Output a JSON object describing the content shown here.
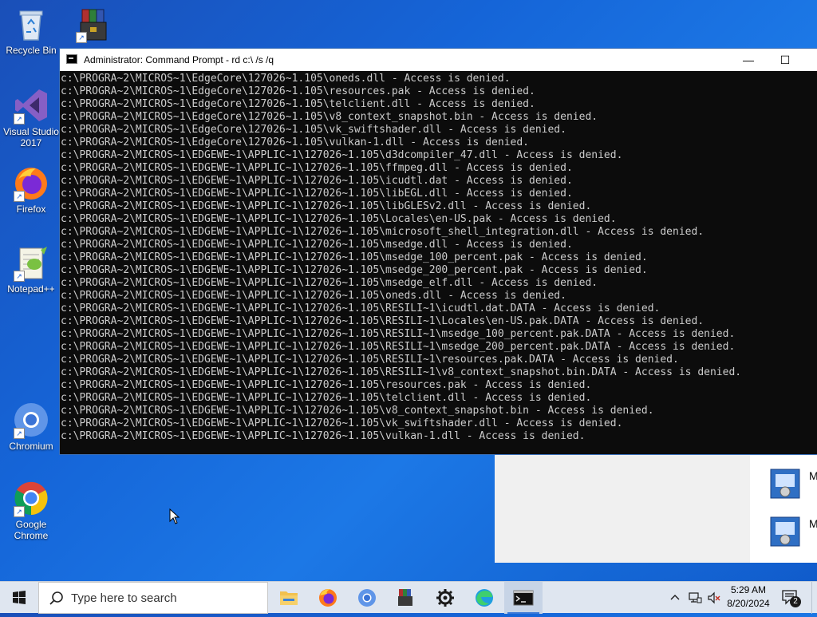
{
  "desktop": {
    "icons": [
      {
        "label": "Recycle Bin",
        "icon": "recycle-bin-icon"
      },
      {
        "label": "",
        "icon": "archive-books-icon"
      },
      {
        "label": "Visual Studio 2017",
        "icon": "visual-studio-icon"
      },
      {
        "label": "Firefox",
        "icon": "firefox-icon"
      },
      {
        "label": "Notepad++",
        "icon": "notepad-plus-plus-icon"
      },
      {
        "label": "Chromium",
        "icon": "chromium-icon"
      },
      {
        "label": "Google Chrome",
        "icon": "google-chrome-icon"
      }
    ],
    "background_window": {
      "items": [
        {
          "label": "M",
          "icon": "installer-icon"
        },
        {
          "label": "M",
          "icon": "installer-icon"
        }
      ]
    }
  },
  "cmd": {
    "title": "Administrator: Command Prompt - rd  c:\\ /s /q",
    "buttons": {
      "minimize": "—",
      "maximize": "☐",
      "close": "✕"
    },
    "lines": [
      "c:\\PROGRA~2\\MICROS~1\\EdgeCore\\127026~1.105\\oneds.dll - Access is denied.",
      "c:\\PROGRA~2\\MICROS~1\\EdgeCore\\127026~1.105\\resources.pak - Access is denied.",
      "c:\\PROGRA~2\\MICROS~1\\EdgeCore\\127026~1.105\\telclient.dll - Access is denied.",
      "c:\\PROGRA~2\\MICROS~1\\EdgeCore\\127026~1.105\\v8_context_snapshot.bin - Access is denied.",
      "c:\\PROGRA~2\\MICROS~1\\EdgeCore\\127026~1.105\\vk_swiftshader.dll - Access is denied.",
      "c:\\PROGRA~2\\MICROS~1\\EdgeCore\\127026~1.105\\vulkan-1.dll - Access is denied.",
      "c:\\PROGRA~2\\MICROS~1\\EDGEWE~1\\APPLIC~1\\127026~1.105\\d3dcompiler_47.dll - Access is denied.",
      "c:\\PROGRA~2\\MICROS~1\\EDGEWE~1\\APPLIC~1\\127026~1.105\\ffmpeg.dll - Access is denied.",
      "c:\\PROGRA~2\\MICROS~1\\EDGEWE~1\\APPLIC~1\\127026~1.105\\icudtl.dat - Access is denied.",
      "c:\\PROGRA~2\\MICROS~1\\EDGEWE~1\\APPLIC~1\\127026~1.105\\libEGL.dll - Access is denied.",
      "c:\\PROGRA~2\\MICROS~1\\EDGEWE~1\\APPLIC~1\\127026~1.105\\libGLESv2.dll - Access is denied.",
      "c:\\PROGRA~2\\MICROS~1\\EDGEWE~1\\APPLIC~1\\127026~1.105\\Locales\\en-US.pak - Access is denied.",
      "c:\\PROGRA~2\\MICROS~1\\EDGEWE~1\\APPLIC~1\\127026~1.105\\microsoft_shell_integration.dll - Access is denied.",
      "c:\\PROGRA~2\\MICROS~1\\EDGEWE~1\\APPLIC~1\\127026~1.105\\msedge.dll - Access is denied.",
      "c:\\PROGRA~2\\MICROS~1\\EDGEWE~1\\APPLIC~1\\127026~1.105\\msedge_100_percent.pak - Access is denied.",
      "c:\\PROGRA~2\\MICROS~1\\EDGEWE~1\\APPLIC~1\\127026~1.105\\msedge_200_percent.pak - Access is denied.",
      "c:\\PROGRA~2\\MICROS~1\\EDGEWE~1\\APPLIC~1\\127026~1.105\\msedge_elf.dll - Access is denied.",
      "c:\\PROGRA~2\\MICROS~1\\EDGEWE~1\\APPLIC~1\\127026~1.105\\oneds.dll - Access is denied.",
      "c:\\PROGRA~2\\MICROS~1\\EDGEWE~1\\APPLIC~1\\127026~1.105\\RESILI~1\\icudtl.dat.DATA - Access is denied.",
      "c:\\PROGRA~2\\MICROS~1\\EDGEWE~1\\APPLIC~1\\127026~1.105\\RESILI~1\\Locales\\en-US.pak.DATA - Access is denied.",
      "c:\\PROGRA~2\\MICROS~1\\EDGEWE~1\\APPLIC~1\\127026~1.105\\RESILI~1\\msedge_100_percent.pak.DATA - Access is denied.",
      "c:\\PROGRA~2\\MICROS~1\\EDGEWE~1\\APPLIC~1\\127026~1.105\\RESILI~1\\msedge_200_percent.pak.DATA - Access is denied.",
      "c:\\PROGRA~2\\MICROS~1\\EDGEWE~1\\APPLIC~1\\127026~1.105\\RESILI~1\\resources.pak.DATA - Access is denied.",
      "c:\\PROGRA~2\\MICROS~1\\EDGEWE~1\\APPLIC~1\\127026~1.105\\RESILI~1\\v8_context_snapshot.bin.DATA - Access is denied.",
      "c:\\PROGRA~2\\MICROS~1\\EDGEWE~1\\APPLIC~1\\127026~1.105\\resources.pak - Access is denied.",
      "c:\\PROGRA~2\\MICROS~1\\EDGEWE~1\\APPLIC~1\\127026~1.105\\telclient.dll - Access is denied.",
      "c:\\PROGRA~2\\MICROS~1\\EDGEWE~1\\APPLIC~1\\127026~1.105\\v8_context_snapshot.bin - Access is denied.",
      "c:\\PROGRA~2\\MICROS~1\\EDGEWE~1\\APPLIC~1\\127026~1.105\\vk_swiftshader.dll - Access is denied.",
      "c:\\PROGRA~2\\MICROS~1\\EDGEWE~1\\APPLIC~1\\127026~1.105\\vulkan-1.dll - Access is denied."
    ]
  },
  "taskbar": {
    "search_placeholder": "Type here to search",
    "apps": [
      "file-explorer-icon",
      "firefox-icon",
      "chromium-icon",
      "archive-icon",
      "settings-icon",
      "edge-icon",
      "command-prompt-icon"
    ],
    "clock": {
      "time": "5:29 AM",
      "date": "8/20/2024"
    },
    "notifications_count": "2"
  },
  "colors": {
    "console_bg": "#0c0c0c",
    "console_text": "#cccccc",
    "desktop_blue": "#1565d8"
  }
}
